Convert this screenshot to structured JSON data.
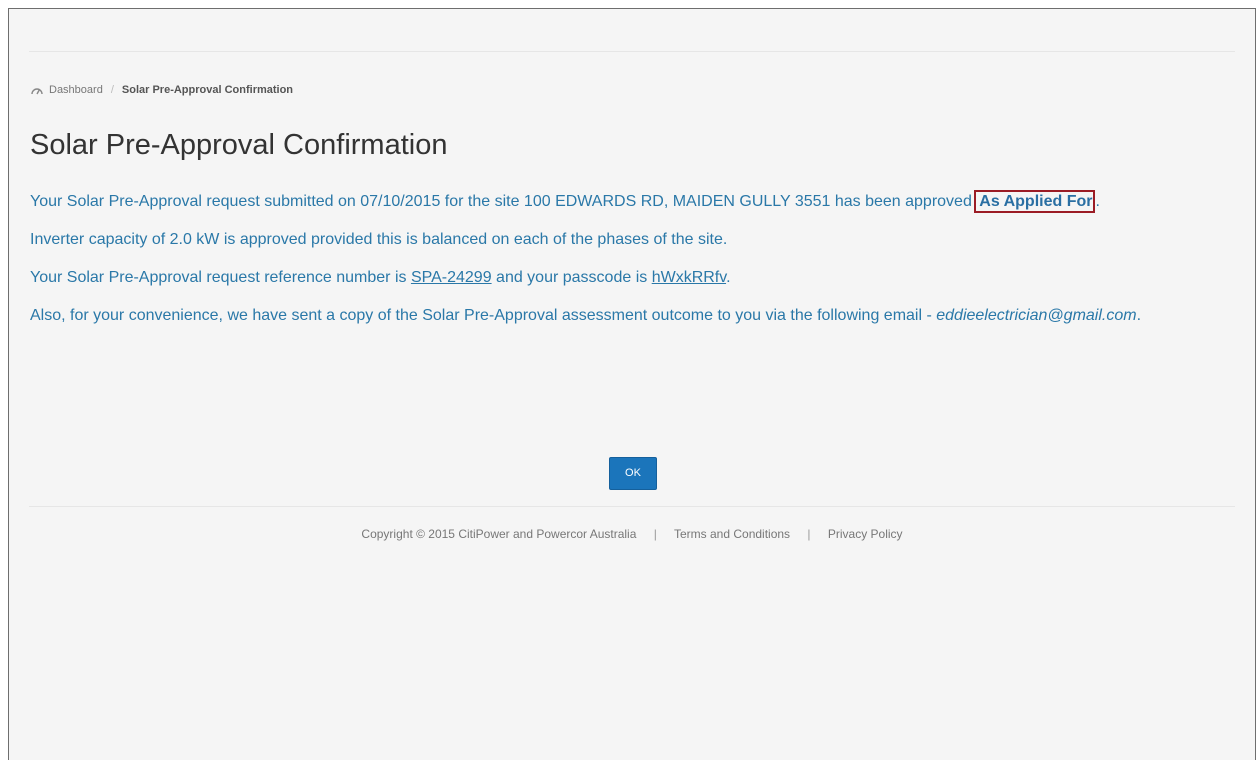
{
  "breadcrumb": {
    "home_label": "Dashboard",
    "separator": "/",
    "current_label": "Solar Pre-Approval Confirmation"
  },
  "page": {
    "title": "Solar Pre-Approval Confirmation"
  },
  "message": {
    "line1_prefix": "Your Solar Pre-Approval request submitted on 07/10/2015 for the site 100 EDWARDS RD, MAIDEN GULLY 3551 has been approved ",
    "approval_status": "As Applied For",
    "line1_suffix": ".",
    "inverter_text": "Inverter capacity of 2.0 kW is approved provided this is balanced on each of the phases of the site.",
    "reference_prefix": "Your Solar Pre-Approval request reference number is ",
    "reference_number": "SPA-24299",
    "passcode_prefix": " and your passcode is ",
    "passcode": "hWxkRRfv",
    "reference_suffix": ".",
    "email_prefix": "Also, for your convenience, we have sent a copy of the Solar Pre-Approval assessment outcome to you via the following email - ",
    "email": "eddieelectrician@gmail.com",
    "email_suffix": "."
  },
  "actions": {
    "ok_label": "OK"
  },
  "footer": {
    "copyright": "Copyright © 2015 CitiPower and Powercor Australia",
    "separator": "|",
    "terms_label": "Terms and Conditions",
    "privacy_label": "Privacy Policy"
  },
  "colors": {
    "message_text": "#2a78a8",
    "highlight_border": "#9b1c25",
    "ok_button": "#1b75bb"
  }
}
